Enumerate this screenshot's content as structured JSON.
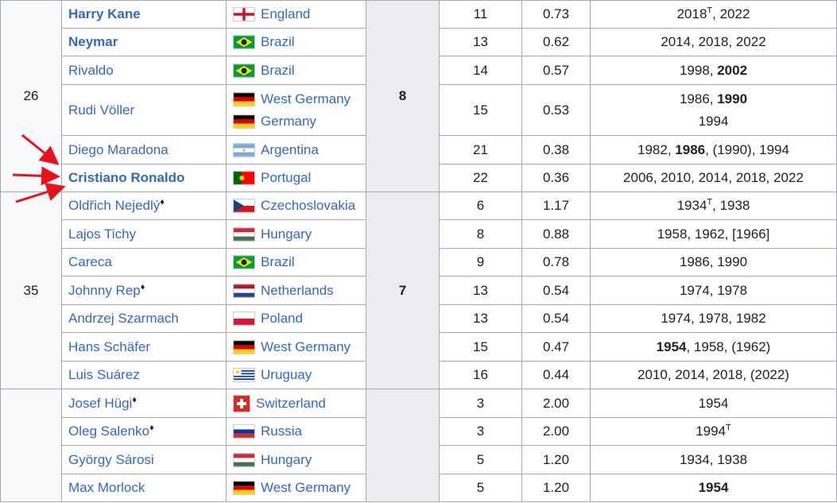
{
  "rank_labels": [
    "26",
    "35",
    ""
  ],
  "goals_labels": [
    "8",
    "7"
  ],
  "rows": [
    {
      "player": "Harry Kane",
      "bold": true,
      "nations": [
        {
          "name": "England",
          "flag": "england"
        }
      ],
      "matches": "11",
      "ratio": "0.73",
      "years": [
        {
          "t": "2018",
          "sup": "T"
        },
        {
          "t": ", 2022"
        }
      ]
    },
    {
      "player": "Neymar",
      "bold": true,
      "nations": [
        {
          "name": "Brazil",
          "flag": "brazil"
        }
      ],
      "matches": "13",
      "ratio": "0.62",
      "years": [
        {
          "t": "2014, 2018, 2022"
        }
      ]
    },
    {
      "player": "Rivaldo",
      "bold": false,
      "nations": [
        {
          "name": "Brazil",
          "flag": "brazil"
        }
      ],
      "matches": "14",
      "ratio": "0.57",
      "years": [
        {
          "t": "1998, "
        },
        {
          "t": "2002",
          "b": true
        }
      ]
    },
    {
      "player": "Rudi Völler",
      "bold": false,
      "nations": [
        {
          "name": "West Germany",
          "flag": "germany"
        },
        {
          "name": "Germany",
          "flag": "germany"
        }
      ],
      "matches": "15",
      "ratio": "0.53",
      "years": [
        {
          "t": "1986, "
        },
        {
          "t": "1990",
          "b": true
        },
        {
          "br": true
        },
        {
          "t": "1994"
        }
      ]
    },
    {
      "player": "Diego Maradona",
      "bold": false,
      "nations": [
        {
          "name": "Argentina",
          "flag": "argentina"
        }
      ],
      "matches": "21",
      "ratio": "0.38",
      "years": [
        {
          "t": "1982, "
        },
        {
          "t": "1986",
          "b": true
        },
        {
          "t": ", (1990), 1994"
        }
      ]
    },
    {
      "player": "Cristiano Ronaldo",
      "bold": true,
      "nations": [
        {
          "name": "Portugal",
          "flag": "portugal"
        }
      ],
      "matches": "22",
      "ratio": "0.36",
      "years": [
        {
          "t": "2006, 2010, 2014, 2018, 2022"
        }
      ]
    },
    {
      "player": "Oldřich Nejedlý",
      "diamond": "♦",
      "bold": false,
      "nations": [
        {
          "name": "Czechoslovakia",
          "flag": "czechoslovakia"
        }
      ],
      "matches": "6",
      "ratio": "1.17",
      "years": [
        {
          "t": "1934",
          "sup": "T"
        },
        {
          "t": ", 1938"
        }
      ]
    },
    {
      "player": "Lajos Tichy",
      "bold": false,
      "nations": [
        {
          "name": "Hungary",
          "flag": "hungary"
        }
      ],
      "matches": "8",
      "ratio": "0.88",
      "years": [
        {
          "t": "1958, 1962, [1966]"
        }
      ]
    },
    {
      "player": "Careca",
      "bold": false,
      "nations": [
        {
          "name": "Brazil",
          "flag": "brazil"
        }
      ],
      "matches": "9",
      "ratio": "0.78",
      "years": [
        {
          "t": "1986, 1990"
        }
      ]
    },
    {
      "player": "Johnny Rep",
      "diamond": "♦",
      "bold": false,
      "nations": [
        {
          "name": "Netherlands",
          "flag": "netherlands"
        }
      ],
      "matches": "13",
      "ratio": "0.54",
      "years": [
        {
          "t": "1974, 1978"
        }
      ]
    },
    {
      "player": "Andrzej Szarmach",
      "bold": false,
      "nations": [
        {
          "name": "Poland",
          "flag": "poland"
        }
      ],
      "matches": "13",
      "ratio": "0.54",
      "years": [
        {
          "t": "1974, 1978, 1982"
        }
      ]
    },
    {
      "player": "Hans Schäfer",
      "bold": false,
      "nations": [
        {
          "name": "West Germany",
          "flag": "germany"
        }
      ],
      "matches": "15",
      "ratio": "0.47",
      "years": [
        {
          "t": "1954",
          "b": true
        },
        {
          "t": ", 1958, (1962)"
        }
      ]
    },
    {
      "player": "Luis Suárez",
      "bold": false,
      "nations": [
        {
          "name": "Uruguay",
          "flag": "uruguay"
        }
      ],
      "matches": "16",
      "ratio": "0.44",
      "years": [
        {
          "t": "2010, 2014, 2018, (2022)"
        }
      ]
    },
    {
      "player": "Josef Hügi",
      "diamond": "♦",
      "bold": false,
      "nations": [
        {
          "name": "Switzerland",
          "flag": "switzerland"
        }
      ],
      "matches": "3",
      "ratio": "2.00",
      "years": [
        {
          "t": "1954"
        }
      ]
    },
    {
      "player": "Oleg Salenko",
      "diamond": "♦",
      "bold": false,
      "nations": [
        {
          "name": "Russia",
          "flag": "russia"
        }
      ],
      "matches": "3",
      "ratio": "2.00",
      "years": [
        {
          "t": "1994",
          "sup": "T"
        }
      ]
    },
    {
      "player": "György Sárosi",
      "bold": false,
      "nations": [
        {
          "name": "Hungary",
          "flag": "hungary"
        }
      ],
      "matches": "5",
      "ratio": "1.20",
      "years": [
        {
          "t": "1934, 1938"
        }
      ]
    },
    {
      "player": "Max Morlock",
      "bold": false,
      "nations": [
        {
          "name": "West Germany",
          "flag": "germany"
        }
      ],
      "matches": "5",
      "ratio": "1.20",
      "years": [
        {
          "t": "1954",
          "b": true
        }
      ]
    }
  ],
  "toc_icon": "list-icon",
  "arrow_color": "#e8111c",
  "link_color": "#3366cc"
}
